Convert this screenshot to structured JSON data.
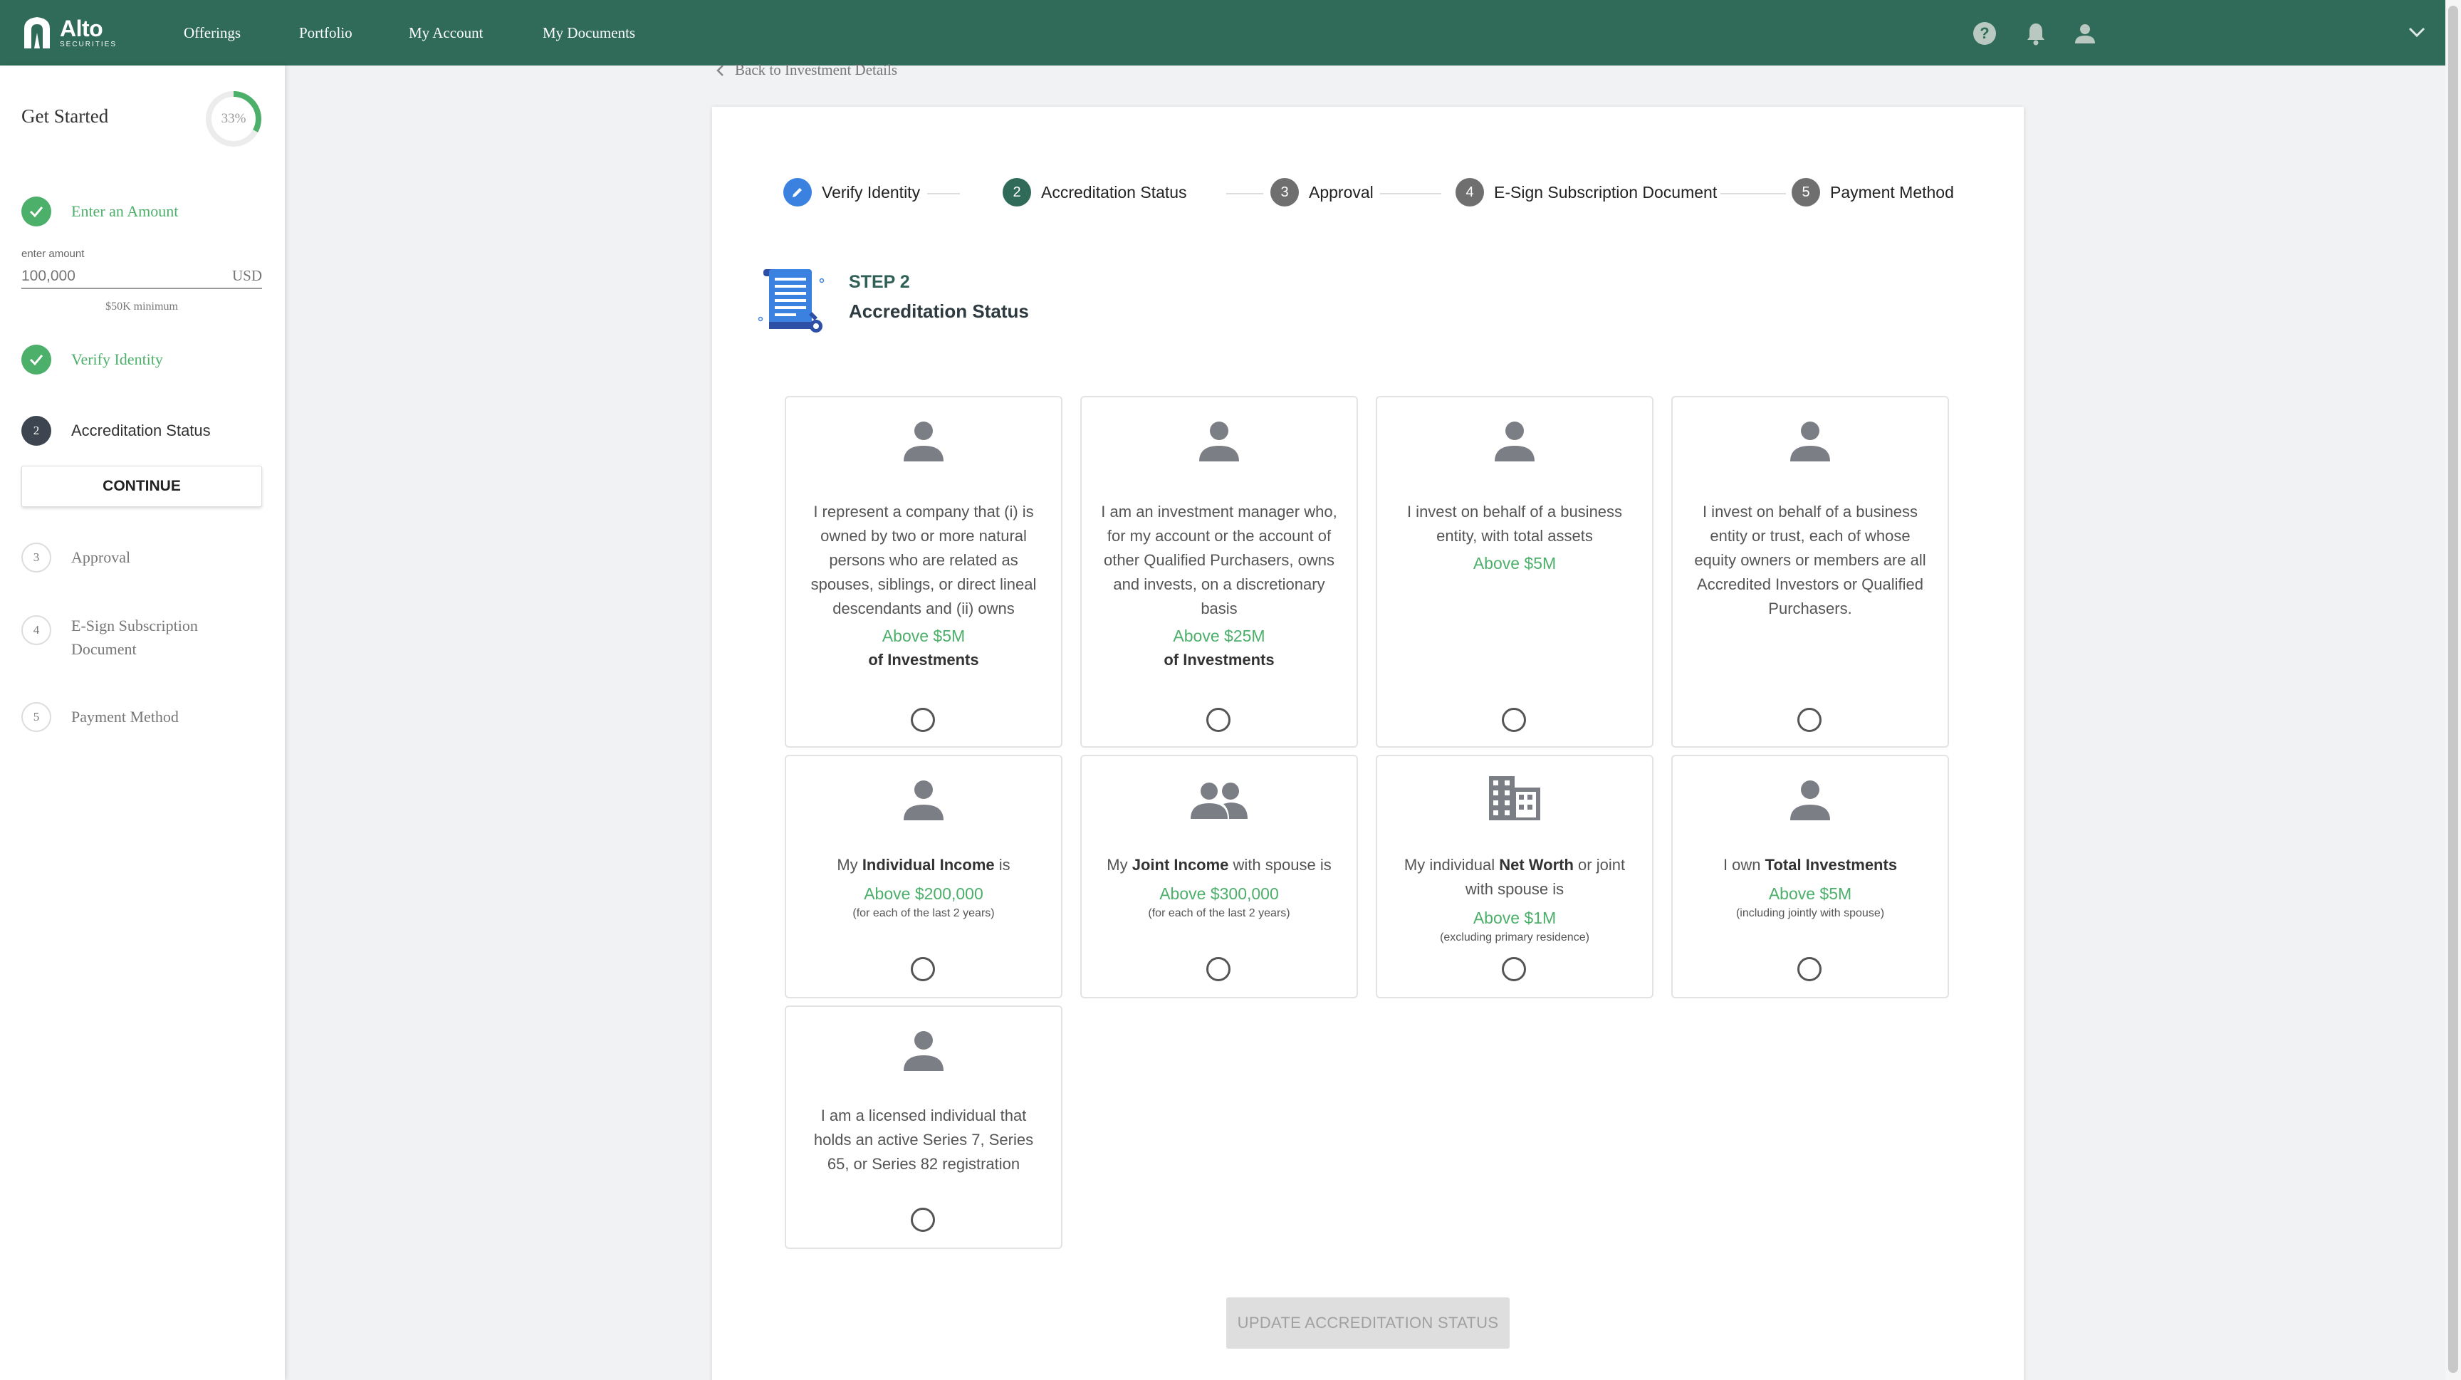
{
  "brand": {
    "name": "Alto",
    "sub": "SECURITIES"
  },
  "nav": [
    "Offerings",
    "Portfolio",
    "My Account",
    "My Documents"
  ],
  "sidebar": {
    "title": "Get Started",
    "progress": "33%",
    "progress_fraction": 0.33,
    "steps": [
      {
        "num": "",
        "label": "Enter an Amount",
        "state": "done"
      },
      {
        "num": "",
        "label": "Verify Identity",
        "state": "done"
      },
      {
        "num": "2",
        "label": "Accreditation Status",
        "state": "active"
      },
      {
        "num": "3",
        "label": "Approval",
        "state": "pending"
      },
      {
        "num": "4",
        "label": "E-Sign Subscription",
        "label2": "Document",
        "state": "pending"
      },
      {
        "num": "5",
        "label": "Payment Method",
        "state": "pending"
      }
    ],
    "amount_label": "enter amount",
    "amount_value": "100,000",
    "amount_currency": "USD",
    "amount_min": "$50K minimum",
    "continue": "CONTINUE"
  },
  "back_link": "Back to Investment Details",
  "stepper": [
    {
      "num": "",
      "label": "Verify Identity"
    },
    {
      "num": "2",
      "label": "Accreditation Status"
    },
    {
      "num": "3",
      "label": "Approval"
    },
    {
      "num": "4",
      "label": "E-Sign Subscription Document"
    },
    {
      "num": "5",
      "label": "Payment Method"
    }
  ],
  "step": {
    "label": "STEP 2",
    "title": "Accreditation Status"
  },
  "options": [
    {
      "text": "I represent a company that (i) is owned by two or more natural persons who are related as spouses, siblings, or direct lineal descendants and (ii) owns",
      "value": "Above $5M",
      "suffix": "of Investments",
      "icon": "person-icon"
    },
    {
      "text": "I am an investment manager who, for my account or the account of other Qualified Purchasers, owns and invests, on a discretionary basis",
      "value": "Above $25M",
      "suffix": "of Investments",
      "icon": "person-icon"
    },
    {
      "text": "I invest on behalf of a business entity, with total assets",
      "value": "Above $5M",
      "suffix": "",
      "icon": "person-icon"
    },
    {
      "text": "I invest on behalf of a business entity or trust, each of whose equity owners or members are all Accredited Investors or Qualified Purchasers.",
      "value": "",
      "suffix": "",
      "icon": "person-icon"
    },
    {
      "pre": "My ",
      "bold": "Individual Income",
      "post": " is",
      "value": "Above $200,000",
      "note": "(for each of the last 2 years)",
      "icon": "person-icon"
    },
    {
      "pre": "My ",
      "bold": "Joint Income",
      "post": " with spouse is",
      "value": "Above $300,000",
      "note": "(for each of the last 2 years)",
      "icon": "people-icon"
    },
    {
      "pre": "My individual ",
      "bold": "Net Worth",
      "post": " or joint with spouse is",
      "value": "Above $1M",
      "note": "(excluding primary residence)",
      "icon": "building-icon"
    },
    {
      "pre": "I own ",
      "bold": "Total Investments",
      "post": "",
      "value": "Above $5M",
      "note": "(including jointly with spouse)",
      "icon": "person-icon"
    },
    {
      "text": "I am a licensed individual that holds an active Series 7, Series 65, or Series 82 registration",
      "value": "",
      "suffix": "",
      "icon": "person-icon"
    }
  ],
  "update_button": "UPDATE ACCREDITATION STATUS",
  "colors": {
    "primary": "#2f6b58",
    "green": "#4caf6a",
    "icon_gray": "#7b7f85"
  }
}
